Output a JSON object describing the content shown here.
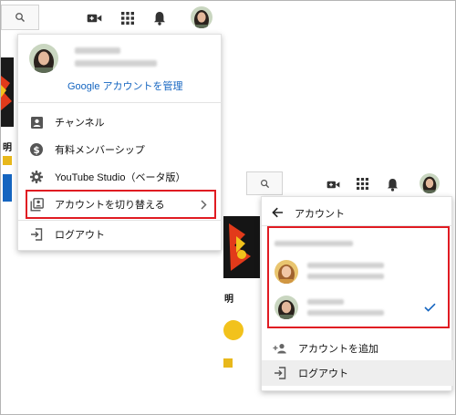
{
  "colors": {
    "accent_blue": "#1565c0",
    "highlight_red": "#e01b22",
    "check_blue": "#1565c0"
  },
  "icons": [
    "search-icon",
    "video-camera-icon",
    "apps-grid-icon",
    "bell-icon",
    "person-icon",
    "dollar-icon",
    "gear-icon",
    "switch-account-icon",
    "chevron-right-icon",
    "logout-icon",
    "arrow-left-icon",
    "add-person-icon",
    "checkmark-icon"
  ],
  "menu1": {
    "manage_link": "Google アカウントを管理",
    "items": [
      {
        "label": "チャンネル"
      },
      {
        "label": "有料メンバーシップ"
      },
      {
        "label": "YouTube Studio（ベータ版）"
      },
      {
        "label": "アカウントを切り替える"
      },
      {
        "label": "ログアウト"
      }
    ]
  },
  "partial": {
    "char1": "明"
  },
  "menu2": {
    "title": "アカウント",
    "add_account": "アカウントを追加",
    "logout": "ログアウト"
  }
}
